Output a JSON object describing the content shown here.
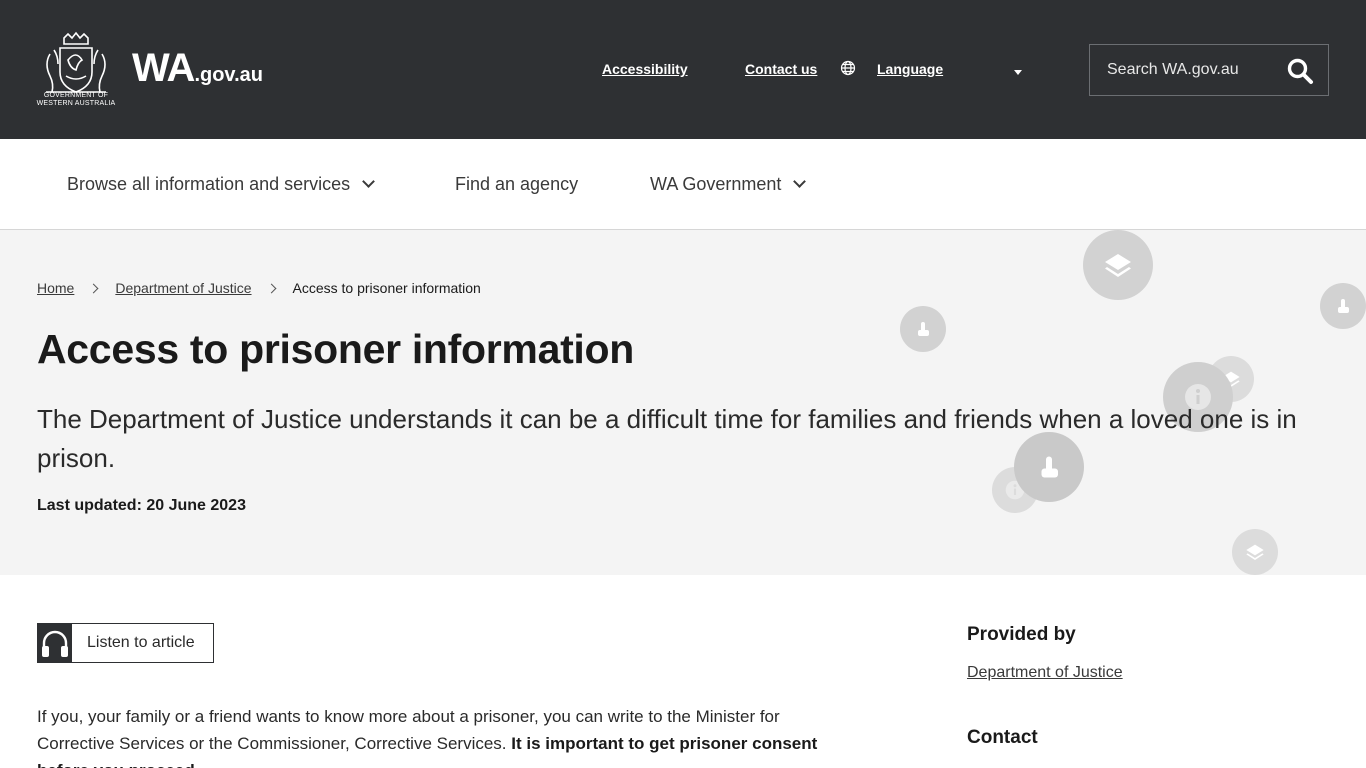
{
  "header": {
    "crest_text": "GOVERNMENT OF WESTERN AUSTRALIA",
    "wordmark_main": "WA",
    "wordmark_suffix": ".gov.au",
    "links": {
      "accessibility": "Accessibility",
      "contact": "Contact us",
      "language": "Language"
    },
    "search": {
      "placeholder": "Search WA.gov.au"
    }
  },
  "nav": {
    "browse": "Browse all information and services",
    "agency": "Find an agency",
    "government": "WA Government"
  },
  "breadcrumb": {
    "home": "Home",
    "department": "Department of Justice",
    "current": "Access to prisoner information"
  },
  "hero": {
    "title": "Access to prisoner information",
    "lead": "The Department of Justice understands it can be a difficult time for families and friends when a loved one is in prison.",
    "updated_label": "Last updated:",
    "updated_date": "20 June 2023"
  },
  "article": {
    "listen_label": "Listen to article",
    "paragraph_plain": "If you, your family or a friend wants to know more about a prisoner, you can write to the Minister for Corrective Services or the Commissioner, Corrective Services.",
    "paragraph_bold": "It is important to get prisoner consent before you proceed."
  },
  "sidebar": {
    "provided_by_heading": "Provided by",
    "provided_by_link": "Department of Justice",
    "contact_heading": "Contact"
  },
  "colors": {
    "header_bg": "#2e3033",
    "hero_bg": "#f4f4f4",
    "bubble": "#d2d2d2"
  }
}
